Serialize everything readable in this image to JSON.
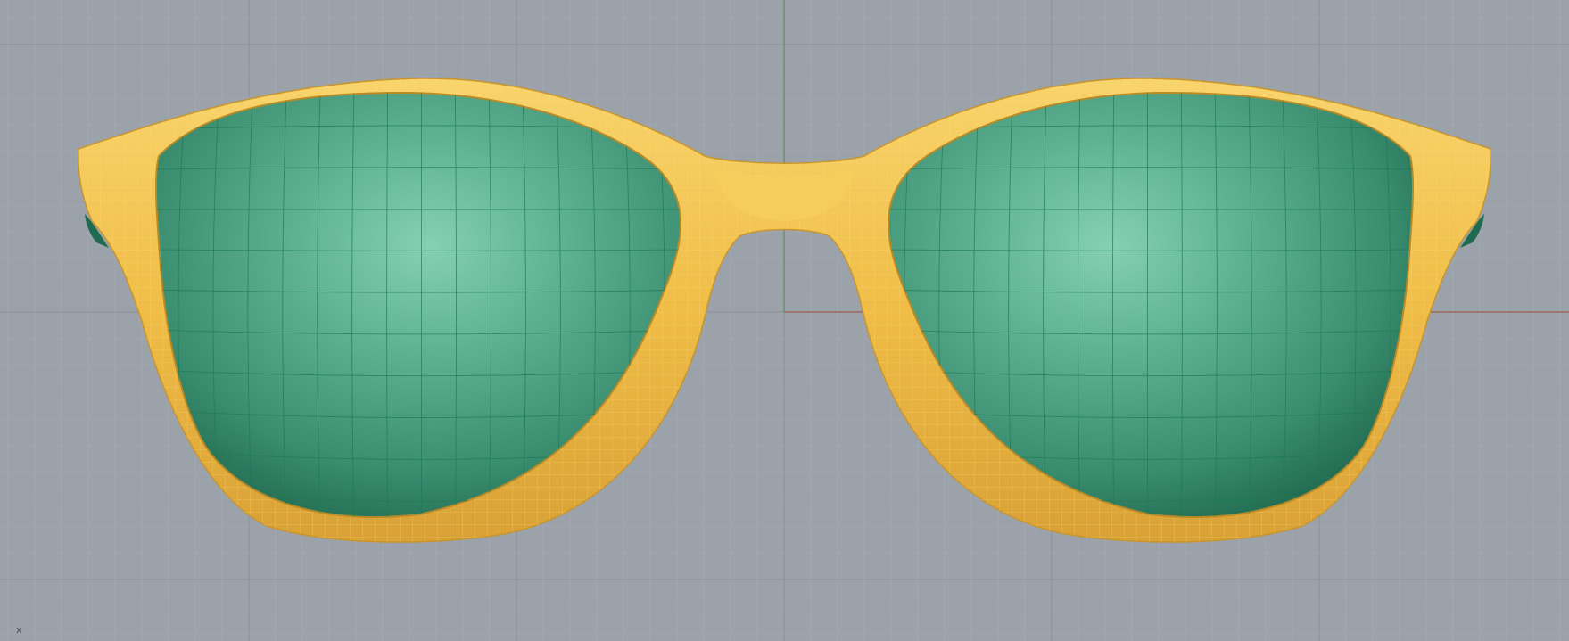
{
  "viewport": {
    "background_color": "#9ca2aa",
    "grid_minor_color": "#a6acb3",
    "grid_major_color": "#8a9098",
    "x_axis_color": "#a0604e",
    "y_axis_color": "#5f8a5f",
    "axis_label": "x"
  },
  "model": {
    "frame_color": "#f2c24e",
    "frame_wire_color": "#f7d56a",
    "frame_shadow_color": "#c9952a",
    "lens_color": "#3f9d7e",
    "lens_highlight_color": "#7cc8ad",
    "lens_shadow_color": "#1f6f54",
    "lens_wire_color": "#1d7a5a"
  }
}
